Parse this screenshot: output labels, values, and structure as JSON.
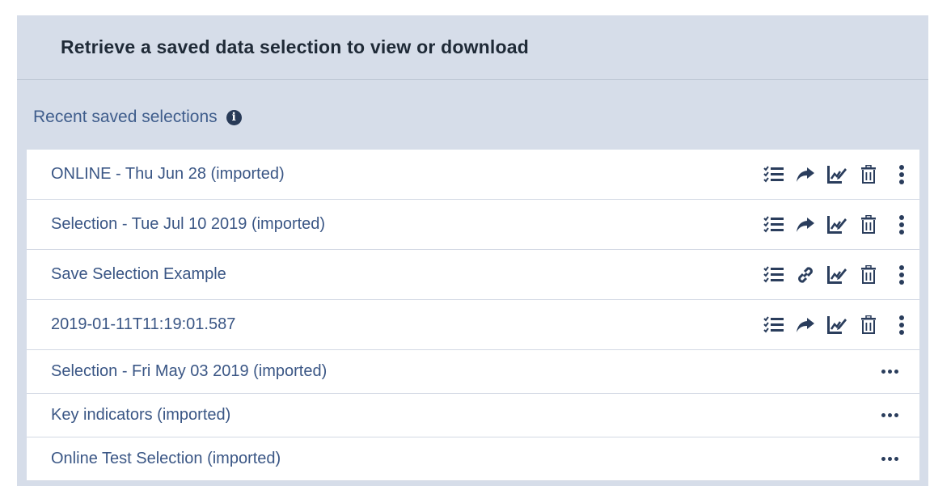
{
  "panel": {
    "title": "Retrieve a saved data selection to view or download",
    "section_label": "Recent saved selections"
  },
  "colors": {
    "panel_bg": "#d6dde9",
    "row_text": "#3a5685",
    "icon": "#2a3d5c"
  },
  "selections": [
    {
      "label": "ONLINE - Thu Jun 28 (imported)",
      "actions": [
        "checklist-icon",
        "share-arrow-icon",
        "edit-chart-icon",
        "trash-icon"
      ],
      "menu": "kebab-menu-icon"
    },
    {
      "label": "Selection - Tue Jul 10 2019 (imported)",
      "actions": [
        "checklist-icon",
        "share-arrow-icon",
        "edit-chart-icon",
        "trash-icon"
      ],
      "menu": "kebab-menu-icon"
    },
    {
      "label": "Save Selection Example",
      "actions": [
        "checklist-icon",
        "link-icon",
        "edit-chart-icon",
        "trash-icon"
      ],
      "menu": "kebab-menu-icon"
    },
    {
      "label": "2019-01-11T11:19:01.587",
      "actions": [
        "checklist-icon",
        "share-arrow-icon",
        "edit-chart-icon",
        "trash-icon"
      ],
      "menu": "kebab-menu-icon"
    },
    {
      "label": "Selection - Fri May 03 2019 (imported)",
      "menu": "more-horizontal-icon"
    },
    {
      "label": "Key indicators (imported)",
      "menu": "more-horizontal-icon"
    },
    {
      "label": "Online Test Selection (imported)",
      "menu": "more-horizontal-icon"
    }
  ]
}
